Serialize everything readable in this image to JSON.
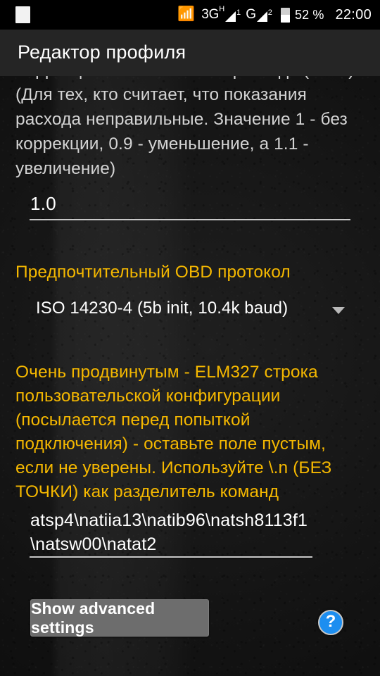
{
  "status_bar": {
    "app_indicator_icon": "white-square-icon",
    "bluetooth_icon": "bluetooth-icon",
    "sim1_network": "3G",
    "sim1_network_sup": "H",
    "sim1_index": "1",
    "sim2_network": "G",
    "sim2_index": "2",
    "battery_icon": "battery-icon",
    "battery_percent": "52 %",
    "time": "22:00"
  },
  "title_bar": {
    "title": "Редактор профиля"
  },
  "mpg_section": {
    "description": "Коррекции экономичности расхода (MPG) (Для тех, кто считает, что показания расхода неправильные. Значение 1 - без коррекции, 0.9 - уменьшение, а 1.1 - увеличение)",
    "value": "1.0"
  },
  "obd_section": {
    "label": "Предпочтительный OBD протокол",
    "selected_option": "ISO 14230-4 (5b init, 10.4k baud)",
    "dropdown_icon": "chevron-down-icon"
  },
  "elm_section": {
    "label": "Очень продвинутым - ELM327 строка пользовательской конфигурации (посылается перед попыткой подключения) - оставьте поле пустым, если не уверены. Используйте \\.n (БЕЗ ТОЧКИ) как разделитель команд",
    "value": "atsp4\\natiia13\\natib96\\natsh8113f1\\natsw00\\natat2",
    "help_icon": "help-question-icon",
    "help_glyph": "?"
  },
  "footer": {
    "advanced_button_label": "Show advanced settings"
  },
  "colors": {
    "accent_amber": "#f5b800",
    "help_blue": "#1d8ef0",
    "button_gray": "#6d6d6d",
    "title_bar": "#252525",
    "text_primary": "#ffffff",
    "text_secondary": "#d3d3d3"
  }
}
